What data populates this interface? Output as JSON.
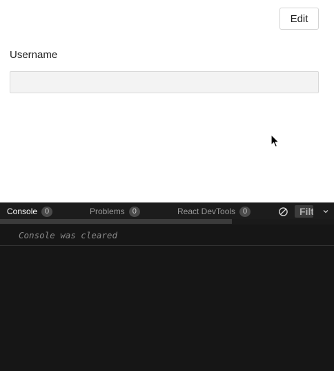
{
  "form": {
    "edit_label": "Edit",
    "username_label": "Username",
    "username_value": "",
    "username_placeholder": ""
  },
  "devtools": {
    "tabs": [
      {
        "label": "Console",
        "count": "0",
        "active": true
      },
      {
        "label": "Problems",
        "count": "0",
        "active": false
      },
      {
        "label": "React DevTools",
        "count": "0",
        "active": false
      }
    ],
    "filter_placeholder": "Filter",
    "console_message": "Console was cleared",
    "icons": {
      "clear": "clear-console-icon",
      "collapse": "chevron-down-icon"
    }
  }
}
